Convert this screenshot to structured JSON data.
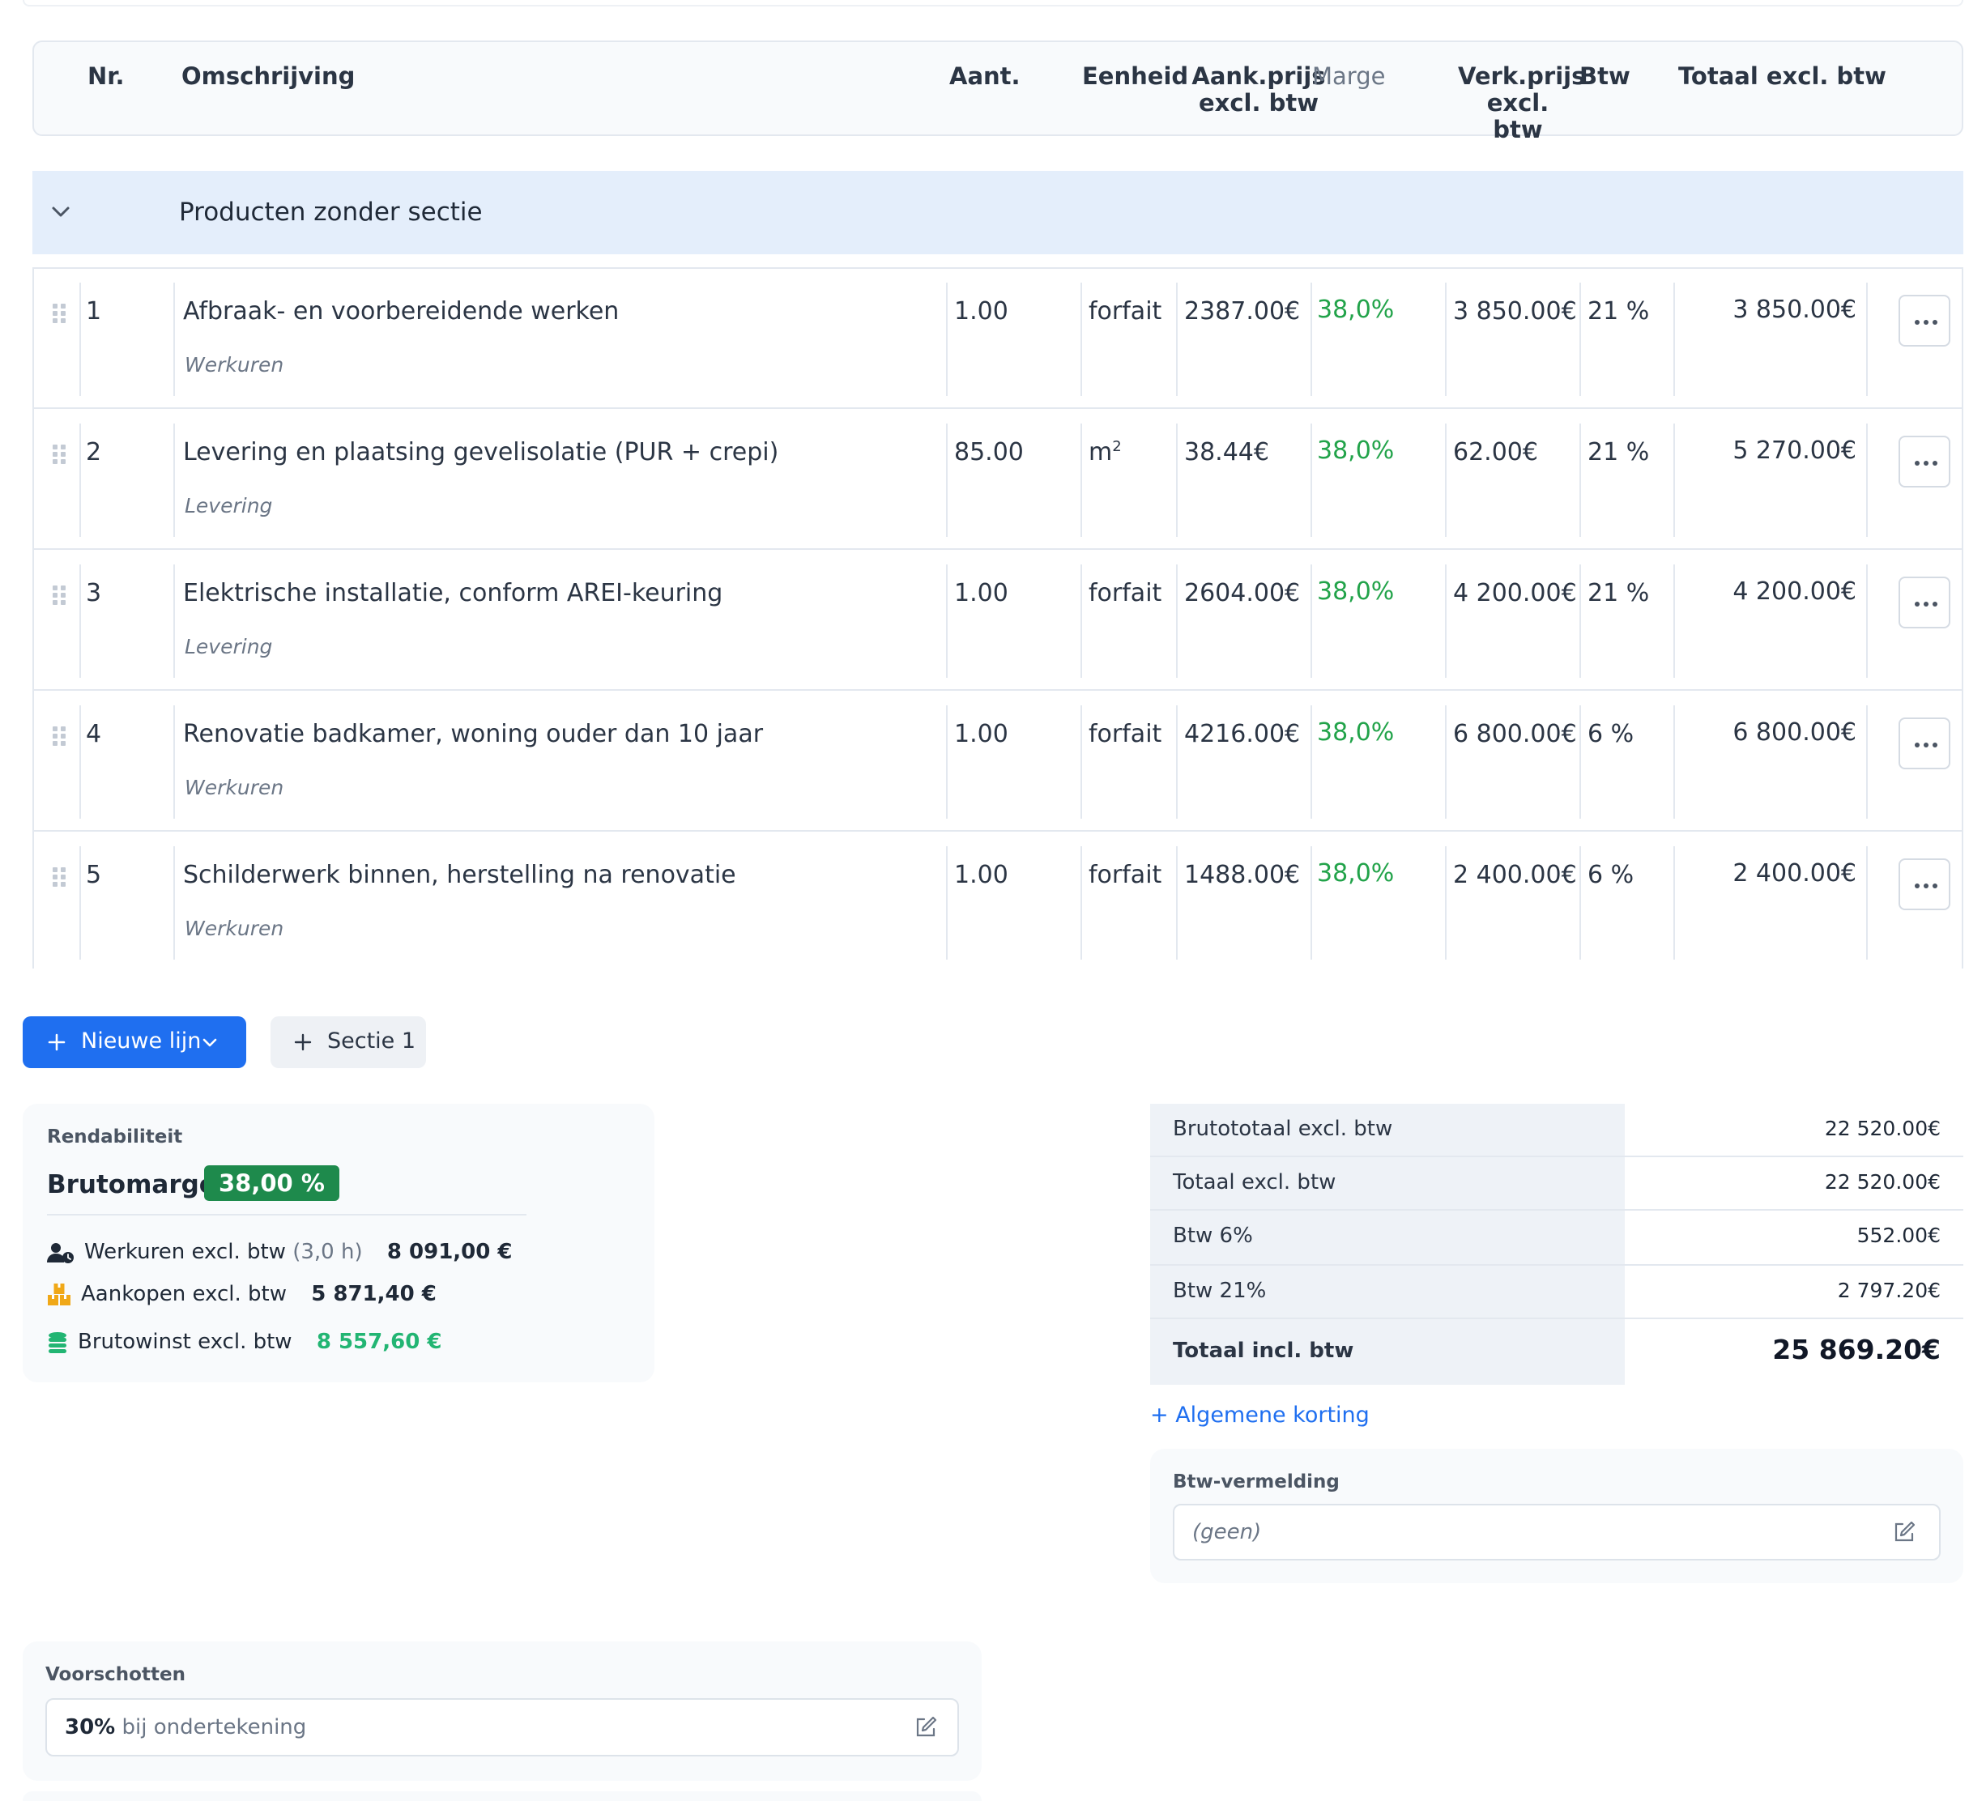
{
  "table_header": {
    "nr": "Nr.",
    "omschrijving": "Omschrijving",
    "aant": "Aant.",
    "eenheid": "Eenheid",
    "aank_1": "Aank.prijs",
    "aank_2": "excl. btw",
    "marge": "Marge",
    "verk_1": "Verk.prijs",
    "verk_2": "excl. btw",
    "btw": "Btw",
    "totaal": "Totaal excl. btw"
  },
  "section": {
    "title": "Producten zonder sectie"
  },
  "rows": [
    {
      "nr": "1",
      "desc": "Afbraak- en voorbereidende werken",
      "type": "Werkuren",
      "qty": "1.00",
      "unit": "forfait",
      "unit_sup": "",
      "aank": "2387.00€",
      "marge": "38,0%",
      "verk": "3 850.00€",
      "btw": "21 %",
      "total": "3 850.00€"
    },
    {
      "nr": "2",
      "desc": "Levering en plaatsing gevelisolatie (PUR + crepi)",
      "type": "Levering",
      "qty": "85.00",
      "unit": "m",
      "unit_sup": "2",
      "aank": "38.44€",
      "marge": "38,0%",
      "verk": "62.00€",
      "btw": "21 %",
      "total": "5 270.00€"
    },
    {
      "nr": "3",
      "desc": "Elektrische installatie, conform AREI-keuring",
      "type": "Levering",
      "qty": "1.00",
      "unit": "forfait",
      "unit_sup": "",
      "aank": "2604.00€",
      "marge": "38,0%",
      "verk": "4 200.00€",
      "btw": "21 %",
      "total": "4 200.00€"
    },
    {
      "nr": "4",
      "desc": "Renovatie badkamer, woning ouder dan 10 jaar",
      "type": "Werkuren",
      "qty": "1.00",
      "unit": "forfait",
      "unit_sup": "",
      "aank": "4216.00€",
      "marge": "38,0%",
      "verk": "6 800.00€",
      "btw": "6 %",
      "total": "6 800.00€"
    },
    {
      "nr": "5",
      "desc": "Schilderwerk binnen, herstelling na renovatie",
      "type": "Werkuren",
      "qty": "1.00",
      "unit": "forfait",
      "unit_sup": "",
      "aank": "1488.00€",
      "marge": "38,0%",
      "verk": "2 400.00€",
      "btw": "6 %",
      "total": "2 400.00€"
    }
  ],
  "buttons": {
    "new_line": "Nieuwe lijn",
    "section_1": "Sectie 1"
  },
  "rendabiliteit": {
    "label": "Rendabiliteit",
    "brutomarge_label": "Brutomarge",
    "brutomarge_value": "38,00 %",
    "werkuren_label": "Werkuren excl. btw",
    "werkuren_hours": "(3,0 h)",
    "werkuren_value": "8 091,00 €",
    "aankopen_label": "Aankopen excl. btw",
    "aankopen_value": "5 871,40 €",
    "brutowinst_label": "Brutowinst excl. btw",
    "brutowinst_value": "8 557,60 €"
  },
  "totals": [
    {
      "label": "Brutototaal excl. btw",
      "value": "22 520.00€"
    },
    {
      "label": "Totaal excl. btw",
      "value": "22 520.00€"
    },
    {
      "label": "Btw 6%",
      "value": "552.00€"
    },
    {
      "label": "Btw 21%",
      "value": "2 797.20€"
    },
    {
      "label": "Totaal incl. btw",
      "value": "25 869.20€"
    }
  ],
  "discount_link": "+ Algemene korting",
  "btw_vermelding": {
    "label": "Btw-vermelding",
    "value": "(geen)"
  },
  "voorschotten": {
    "label": "Voorschotten",
    "percent": "30%",
    "text": "bij ondertekening"
  },
  "colors": {
    "primary": "#1f6ff0",
    "margin_green": "#22a34a",
    "badge_green": "#1e8a4c",
    "section_bg": "#e4eefb"
  }
}
